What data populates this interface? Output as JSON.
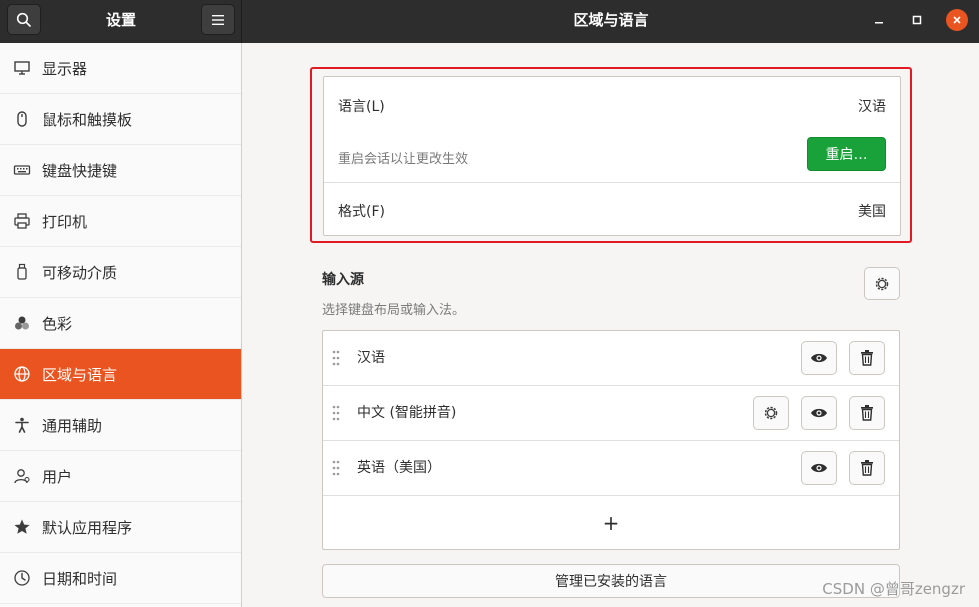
{
  "header": {
    "sidebar_title": "设置",
    "main_title": "区域与语言",
    "search_icon": "search-icon",
    "menu_icon": "hamburger-menu-icon"
  },
  "sidebar": {
    "items": [
      {
        "label": "显示器",
        "icon": "display-icon",
        "active": false
      },
      {
        "label": "鼠标和触摸板",
        "icon": "mouse-icon",
        "active": false
      },
      {
        "label": "键盘快捷键",
        "icon": "keyboard-icon",
        "active": false
      },
      {
        "label": "打印机",
        "icon": "printer-icon",
        "active": false
      },
      {
        "label": "可移动介质",
        "icon": "usb-drive-icon",
        "active": false
      },
      {
        "label": "色彩",
        "icon": "color-circles-icon",
        "active": false
      },
      {
        "label": "区域与语言",
        "icon": "globe-icon",
        "active": true
      },
      {
        "label": "通用辅助",
        "icon": "accessibility-icon",
        "active": false
      },
      {
        "label": "用户",
        "icon": "user-icon",
        "active": false
      },
      {
        "label": "默认应用程序",
        "icon": "star-icon",
        "active": false
      },
      {
        "label": "日期和时间",
        "icon": "clock-icon",
        "active": false
      }
    ]
  },
  "language": {
    "label": "语言(L)",
    "value": "汉语",
    "restart_hint": "重启会话以让更改生效",
    "restart_button": "重启…",
    "format_label": "格式(F)",
    "format_value": "美国"
  },
  "input_sources": {
    "title": "输入源",
    "subtitle": "选择键盘布局或输入法。",
    "items": [
      {
        "label": "汉语",
        "has_settings": false
      },
      {
        "label": "中文 (智能拼音)",
        "has_settings": true
      },
      {
        "label": "英语（美国）",
        "has_settings": false
      }
    ],
    "add_label": "+"
  },
  "manage_button": "管理已安装的语言",
  "watermark": "CSDN @曾哥zengzr",
  "colors": {
    "accent": "#e95420",
    "restart_green": "#1aa23a",
    "highlight_red": "#e01b24",
    "header_bg": "#2d2d2d"
  }
}
